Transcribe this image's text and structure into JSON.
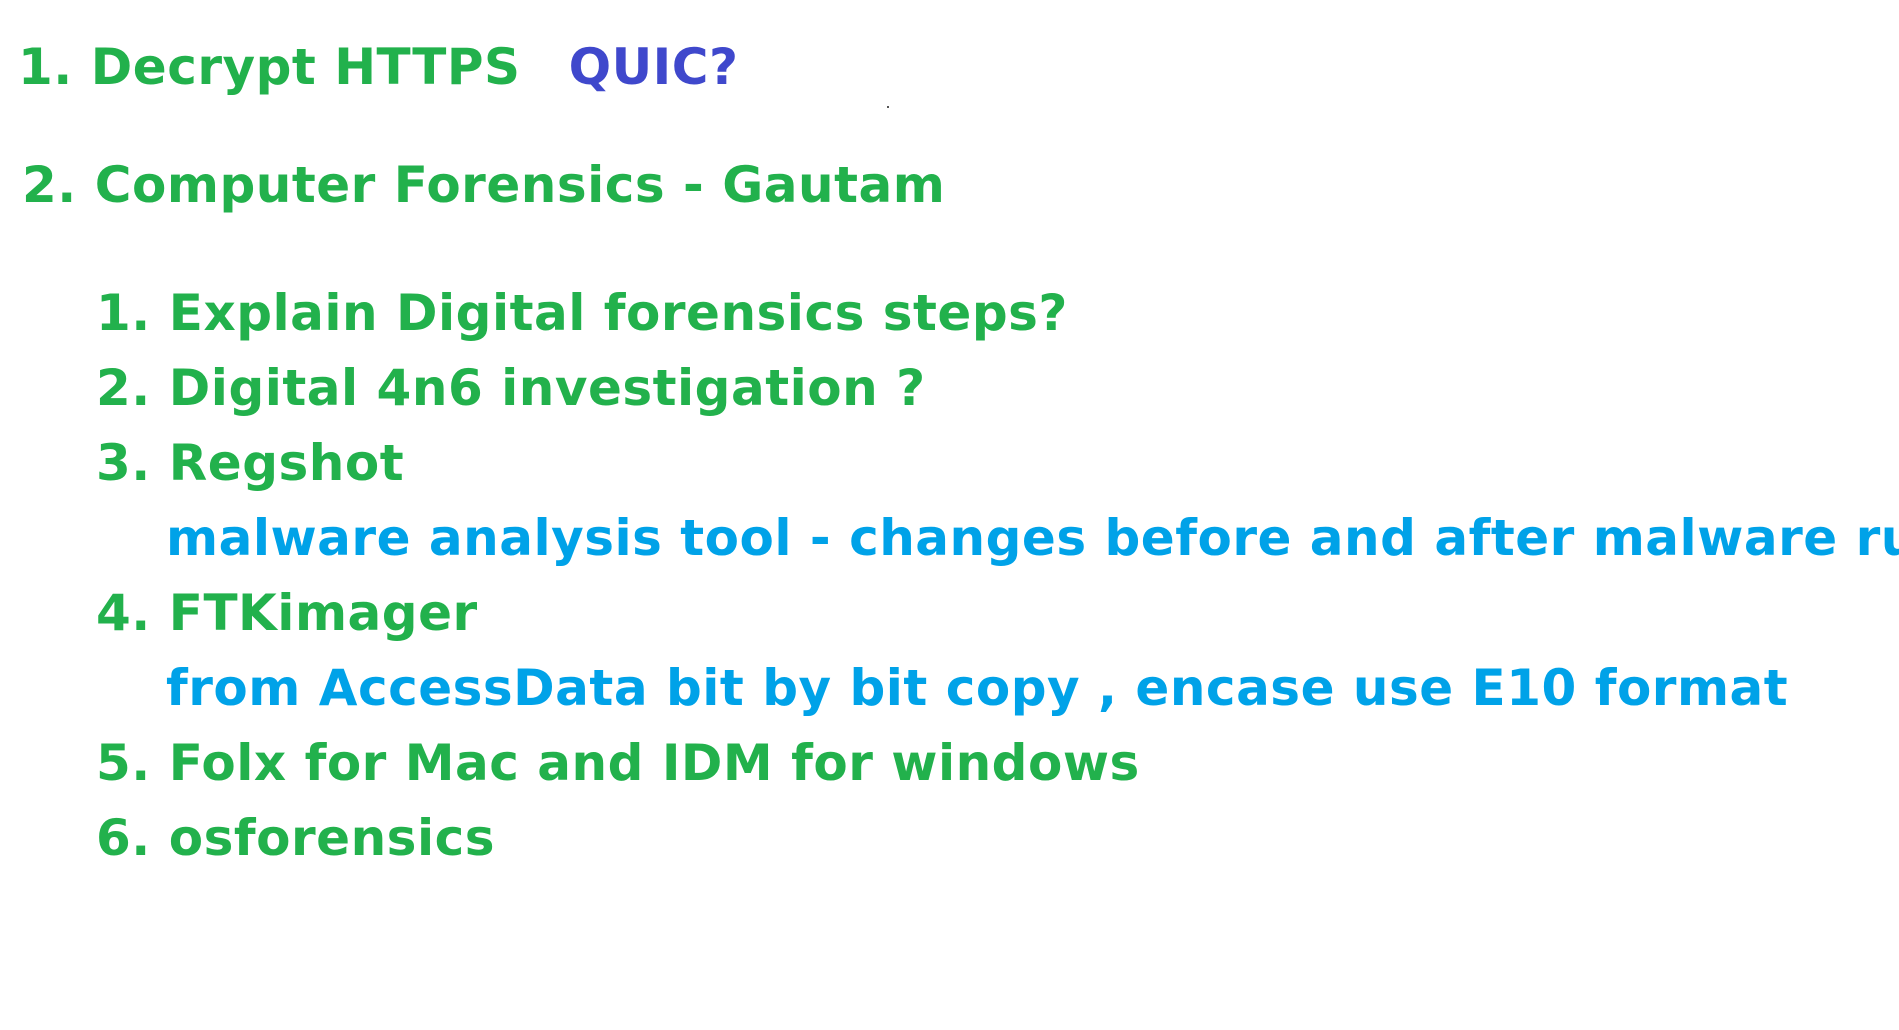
{
  "top_items": [
    {
      "number": "1.",
      "text": "Decrypt HTTPS",
      "extra": "QUIC?"
    },
    {
      "number": "2.",
      "text": "Computer Forensics - Gautam"
    }
  ],
  "sub_items": [
    {
      "number": "1.",
      "text": "Explain Digital forensics steps?"
    },
    {
      "number": "2.",
      "text": "Digital 4n6 investigation ?"
    },
    {
      "number": "3.",
      "text": "Regshot",
      "note": "malware analysis tool - changes before and after malware run"
    },
    {
      "number": "4.",
      "text": "FTKimager",
      "note": "from AccessData bit by bit copy , encase use E10 format"
    },
    {
      "number": "5.",
      "text": "Folx for Mac and IDM for windows"
    },
    {
      "number": "6.",
      "text": "osforensics"
    }
  ],
  "colors": {
    "heading": "#22b14c",
    "note": "#00a2e8",
    "extra": "#3f48cc"
  }
}
